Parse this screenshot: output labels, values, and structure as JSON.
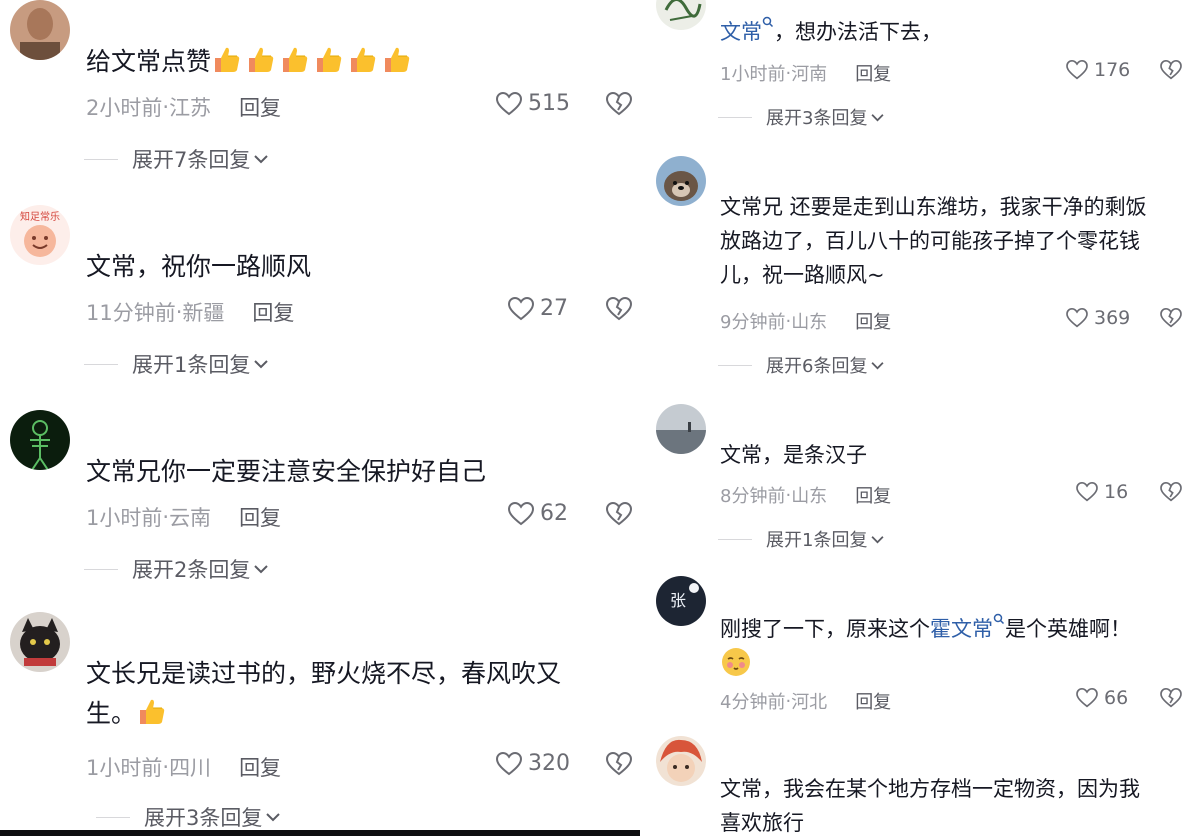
{
  "left_comments": [
    {
      "text": "给文常点赞",
      "thumb_count": 6,
      "time": "2小时前",
      "location": "江苏",
      "reply": "回复",
      "likes": "515",
      "expand": "展开7条回复",
      "avatar_colors": [
        "#b98a6f",
        "#5b4535"
      ]
    },
    {
      "text": "文常，祝你一路顺风",
      "avatar_badge": "知足常乐",
      "time": "11分钟前",
      "location": "新疆",
      "reply": "回复",
      "likes": "27",
      "expand": "展开1条回复",
      "avatar_colors": [
        "#fbe3df",
        "#f5b7a1"
      ]
    },
    {
      "text": "文常兄你一定要注意安全保护好自己",
      "time": "1小时前",
      "location": "云南",
      "reply": "回复",
      "likes": "62",
      "expand": "展开2条回复",
      "avatar_colors": [
        "#0c2410",
        "#4cae58"
      ]
    },
    {
      "text_line1": "文长兄是读过书的，野火烧不尽，春风吹又",
      "text_line2": "生。",
      "time": "1小时前",
      "location": "四川",
      "reply": "回复",
      "likes": "320",
      "expand": "展开3条回复",
      "avatar_colors": [
        "#2a2626",
        "#c24141"
      ]
    }
  ],
  "right_comments": [
    {
      "link": "文常",
      "text": "，想办法活下去，",
      "time": "1小时前",
      "location": "河南",
      "reply": "回复",
      "likes": "176",
      "expand": "展开3条回复",
      "avatar_colors": [
        "#e9ebe4",
        "#3f6b3b"
      ]
    },
    {
      "text_line1": "文常兄  还要是走到山东潍坊，我家干净的剩饭",
      "text_line2": "放路边了，百儿八十的可能孩子掉了个零花钱",
      "text_line3": "儿，祝一路顺风~",
      "time": "9分钟前",
      "location": "山东",
      "reply": "回复",
      "likes": "369",
      "expand": "展开6条回复",
      "avatar_colors": [
        "#86a8c8",
        "#5c4a3a"
      ]
    },
    {
      "text": "文常，是条汉子",
      "time": "8分钟前",
      "location": "山东",
      "reply": "回复",
      "likes": "16",
      "expand": "展开1条回复",
      "avatar_colors": [
        "#b6bcc2",
        "#5a636c"
      ]
    },
    {
      "text_before": "刚搜了一下，原来这个",
      "link": "霍文常",
      "text_after": "是个英雄啊！",
      "avatar_char": "张",
      "time": "4分钟前",
      "location": "河北",
      "reply": "回复",
      "likes": "66",
      "avatar_colors": [
        "#1d2533",
        "#eef2f8"
      ]
    },
    {
      "text_line1": "文常，我会在某个地方存档一定物资，因为我",
      "text_line2": "喜欢旅行",
      "avatar_colors": [
        "#e06a4e",
        "#f3d2b9"
      ]
    }
  ],
  "separator": " · ",
  "colors": {
    "text": "#161823",
    "meta": "#9b9ca3",
    "link": "#2f5fa8"
  }
}
